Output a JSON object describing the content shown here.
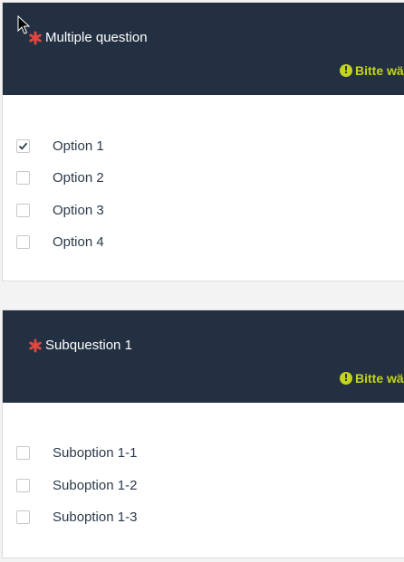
{
  "questions": [
    {
      "title": "Multiple question",
      "hint": "Bitte wä",
      "options": [
        {
          "label": "Option 1",
          "checked": true
        },
        {
          "label": "Option 2",
          "checked": false
        },
        {
          "label": "Option 3",
          "checked": false
        },
        {
          "label": "Option 4",
          "checked": false
        }
      ]
    },
    {
      "title": "Subquestion 1",
      "hint": "Bitte wä",
      "options": [
        {
          "label": "Suboption 1-1",
          "checked": false
        },
        {
          "label": "Suboption 1-2",
          "checked": false
        },
        {
          "label": "Suboption 1-3",
          "checked": false
        }
      ]
    }
  ],
  "icons": {
    "required": "asterisk-icon",
    "hint": "exclamation-circle-icon",
    "check": "checkmark-icon",
    "cursor": "mouse-pointer-icon"
  },
  "colors": {
    "header_bg": "#233041",
    "required": "#e2463f",
    "hint": "#c4d31d",
    "text": "#2b3a4a"
  }
}
